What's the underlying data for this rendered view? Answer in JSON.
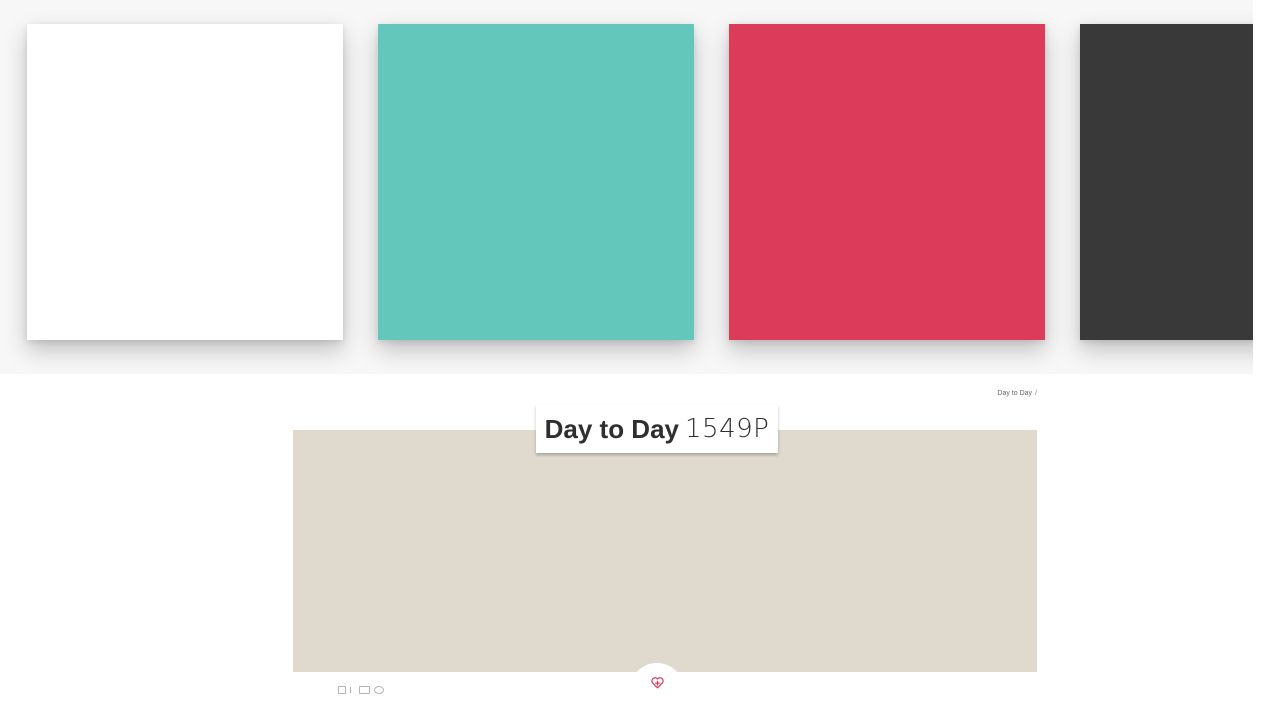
{
  "swatches": [
    {
      "name": "white",
      "color": "#ffffff"
    },
    {
      "name": "teal",
      "color": "#64c7bc"
    },
    {
      "name": "red",
      "color": "#dc3c59"
    },
    {
      "name": "charcoal",
      "color": "#393939"
    }
  ],
  "breadcrumb": {
    "item": "Day to Day",
    "separator": "/"
  },
  "color": {
    "name": "Day to Day",
    "code": "1549P",
    "hex": "#dfd9ce"
  },
  "favorite": {
    "icon": "heart-plus-icon",
    "accent": "#dc3c59"
  },
  "mini_actions": [
    {
      "icon": "share-icon"
    },
    {
      "icon": "link-icon"
    },
    {
      "icon": "mail-icon"
    },
    {
      "icon": "pinterest-icon"
    }
  ]
}
